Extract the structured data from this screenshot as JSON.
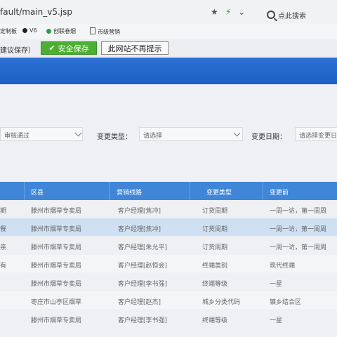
{
  "browser": {
    "url": "fault/main_v5.jsp",
    "search_label": "点此搜索",
    "bookmarks": [
      "定制板",
      "V6",
      "创联卷烟",
      "市级营销"
    ]
  },
  "infobar": {
    "hint": "建议保存）",
    "save_label": "安全保存",
    "dismiss_label": "此网站不再提示"
  },
  "filters": {
    "status_value": "审核通过",
    "type_label": "变更类型：",
    "type_placeholder": "请选择",
    "date_label": "变更日期：",
    "date_placeholder": "请选择变更日"
  },
  "table": {
    "headers": [
      "区县",
      "营销线路",
      "变更类型",
      "变更前"
    ],
    "rows": [
      {
        "edge": "期",
        "county": "滕州市烟草专卖局",
        "route": "客户经理[焦冲]",
        "type": "订货周期",
        "before": "一周一访，第一周周"
      },
      {
        "edge": "餐",
        "county": "滕州市烟草专卖局",
        "route": "客户经理[焦冲]",
        "type": "订货周期",
        "before": "一周一访，第一周周"
      },
      {
        "edge": "亲",
        "county": "滕州市烟草专卖局",
        "route": "客户经理[朱允平]",
        "type": "订货周期",
        "before": "一周一访，第一周周"
      },
      {
        "edge": "有",
        "county": "滕州市烟草专卖局",
        "route": "客户经理[赵恒会]",
        "type": "终端类别",
        "before": "现代终端"
      },
      {
        "edge": "",
        "county": "滕州市烟草专卖局",
        "route": "客户经理[李书强]",
        "type": "终端等级",
        "before": "一星"
      },
      {
        "edge": "",
        "county": "枣庄市山亭区烟草",
        "route": "客户经理[赵杰]",
        "type": "城乡分类代码",
        "before": "镇乡结合区"
      },
      {
        "edge": "",
        "county": "滕州市烟草专卖局",
        "route": "客户经理[李书强]",
        "type": "终端等级",
        "before": "一星"
      }
    ]
  },
  "colors": {
    "accent": "#2d72d6",
    "save_green": "#4caf32",
    "table_header": "#3f86d8",
    "row_highlight": "#cfe0f3"
  }
}
